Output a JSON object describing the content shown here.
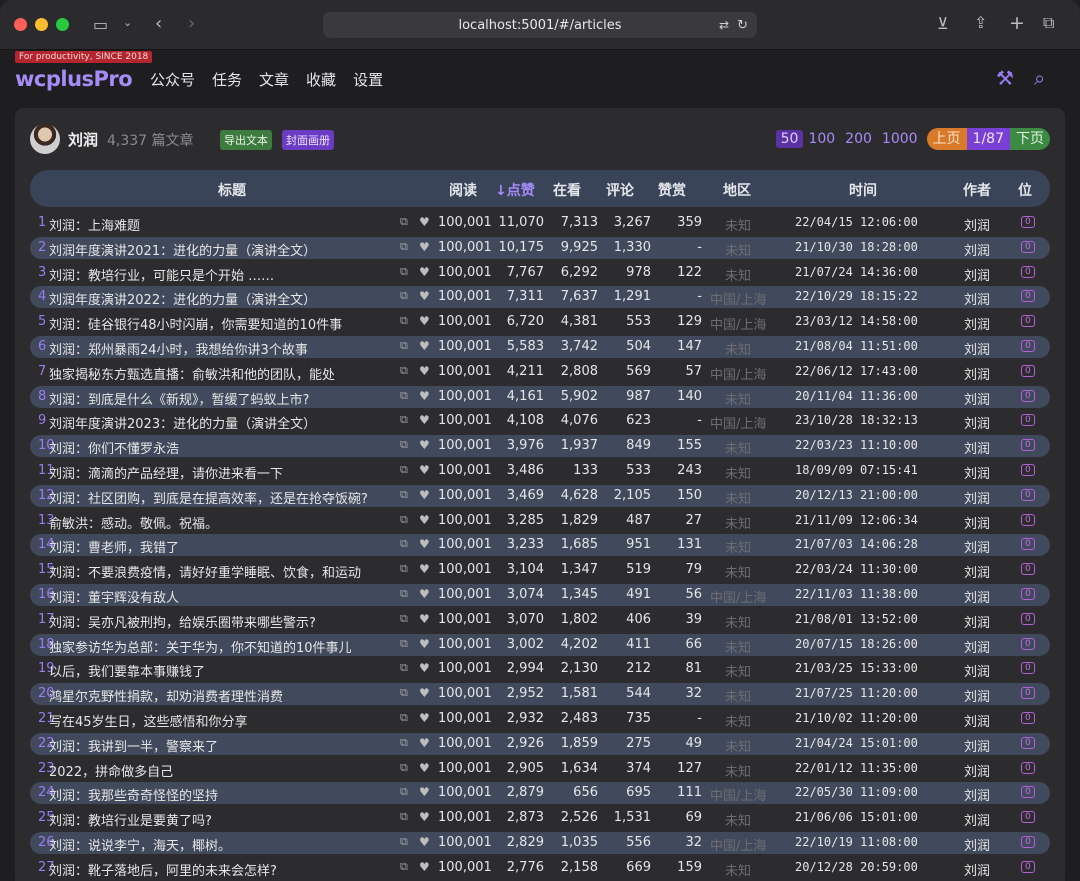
{
  "browser": {
    "url": "localhost:5001/#/articles"
  },
  "app": {
    "tagline": "For productivity, SINCE 2018",
    "logo": "wcplusPro",
    "nav": [
      "公众号",
      "任务",
      "文章",
      "收藏",
      "设置"
    ]
  },
  "header": {
    "author": "刘润",
    "count": "4,337 篇文章",
    "export_btn": "导出文本",
    "cover_btn": "封面画册",
    "page_sizes": [
      "50",
      "100",
      "200",
      "1000"
    ],
    "active_page_size": "50",
    "prev": "上页",
    "current": "1/87",
    "next": "下页"
  },
  "columns": {
    "title": "标题",
    "read": "阅读",
    "like": "↓点赞",
    "watch": "在看",
    "comment": "评论",
    "reward": "赞赏",
    "region": "地区",
    "time": "时间",
    "author": "作者",
    "pos": "位"
  },
  "rows": [
    {
      "i": "1",
      "t": "刘润：上海难题",
      "r": "100,001",
      "l": "11,070",
      "w": "7,313",
      "c": "3,267",
      "z": "359",
      "g": "未知",
      "d": "22/04/15 12:06:00",
      "a": "刘润",
      "p": "0"
    },
    {
      "i": "2",
      "t": "刘润年度演讲2021：进化的力量（演讲全文）",
      "r": "100,001",
      "l": "10,175",
      "w": "9,925",
      "c": "1,330",
      "z": "-",
      "g": "未知",
      "d": "21/10/30 18:28:00",
      "a": "刘润",
      "p": "0"
    },
    {
      "i": "3",
      "t": "刘润：教培行业，可能只是个开始 ……",
      "r": "100,001",
      "l": "7,767",
      "w": "6,292",
      "c": "978",
      "z": "122",
      "g": "未知",
      "d": "21/07/24 14:36:00",
      "a": "刘润",
      "p": "0"
    },
    {
      "i": "4",
      "t": "刘润年度演讲2022：进化的力量（演讲全文）",
      "r": "100,001",
      "l": "7,311",
      "w": "7,637",
      "c": "1,291",
      "z": "-",
      "g": "中国/上海",
      "d": "22/10/29 18:15:22",
      "a": "刘润",
      "p": "0"
    },
    {
      "i": "5",
      "t": "刘润：硅谷银行48小时闪崩，你需要知道的10件事",
      "r": "100,001",
      "l": "6,720",
      "w": "4,381",
      "c": "553",
      "z": "129",
      "g": "中国/上海",
      "d": "23/03/12 14:58:00",
      "a": "刘润",
      "p": "0"
    },
    {
      "i": "6",
      "t": "刘润：郑州暴雨24小时，我想给你讲3个故事",
      "r": "100,001",
      "l": "5,583",
      "w": "3,742",
      "c": "504",
      "z": "147",
      "g": "未知",
      "d": "21/08/04 11:51:00",
      "a": "刘润",
      "p": "0"
    },
    {
      "i": "7",
      "t": "独家揭秘东方甄选直播：俞敏洪和他的团队，能处",
      "r": "100,001",
      "l": "4,211",
      "w": "2,808",
      "c": "569",
      "z": "57",
      "g": "中国/上海",
      "d": "22/06/12 17:43:00",
      "a": "刘润",
      "p": "0"
    },
    {
      "i": "8",
      "t": "刘润：到底是什么《新规》，暂缓了蚂蚁上市?",
      "r": "100,001",
      "l": "4,161",
      "w": "5,902",
      "c": "987",
      "z": "140",
      "g": "未知",
      "d": "20/11/04 11:36:00",
      "a": "刘润",
      "p": "0"
    },
    {
      "i": "9",
      "t": "刘润年度演讲2023：进化的力量（演讲全文）",
      "r": "100,001",
      "l": "4,108",
      "w": "4,076",
      "c": "623",
      "z": "-",
      "g": "中国/上海",
      "d": "23/10/28 18:32:13",
      "a": "刘润",
      "p": "0"
    },
    {
      "i": "10",
      "t": "刘润：你们不懂罗永浩",
      "r": "100,001",
      "l": "3,976",
      "w": "1,937",
      "c": "849",
      "z": "155",
      "g": "未知",
      "d": "22/03/23 11:10:00",
      "a": "刘润",
      "p": "0"
    },
    {
      "i": "11",
      "t": "刘润：滴滴的产品经理，请你进来看一下",
      "r": "100,001",
      "l": "3,486",
      "w": "133",
      "c": "533",
      "z": "243",
      "g": "未知",
      "d": "18/09/09 07:15:41",
      "a": "刘润",
      "p": "0"
    },
    {
      "i": "12",
      "t": "刘润：社区团购，到底是在提高效率，还是在抢夺饭碗?",
      "r": "100,001",
      "l": "3,469",
      "w": "4,628",
      "c": "2,105",
      "z": "150",
      "g": "未知",
      "d": "20/12/13 21:00:00",
      "a": "刘润",
      "p": "0"
    },
    {
      "i": "13",
      "t": "俞敏洪：感动。敬佩。祝福。",
      "r": "100,001",
      "l": "3,285",
      "w": "1,829",
      "c": "487",
      "z": "27",
      "g": "未知",
      "d": "21/11/09 12:06:34",
      "a": "刘润",
      "p": "0"
    },
    {
      "i": "14",
      "t": "刘润：曹老师，我错了",
      "r": "100,001",
      "l": "3,233",
      "w": "1,685",
      "c": "951",
      "z": "131",
      "g": "未知",
      "d": "21/07/03 14:06:28",
      "a": "刘润",
      "p": "0"
    },
    {
      "i": "15",
      "t": "刘润：不要浪费疫情，请好好重学睡眠、饮食，和运动",
      "r": "100,001",
      "l": "3,104",
      "w": "1,347",
      "c": "519",
      "z": "79",
      "g": "未知",
      "d": "22/03/24 11:30:00",
      "a": "刘润",
      "p": "0"
    },
    {
      "i": "16",
      "t": "刘润：董宇辉没有敌人",
      "r": "100,001",
      "l": "3,074",
      "w": "1,345",
      "c": "491",
      "z": "56",
      "g": "中国/上海",
      "d": "22/11/03 11:38:00",
      "a": "刘润",
      "p": "0"
    },
    {
      "i": "17",
      "t": "刘润：吴亦凡被刑拘，给娱乐圈带来哪些警示?",
      "r": "100,001",
      "l": "3,070",
      "w": "1,802",
      "c": "406",
      "z": "39",
      "g": "未知",
      "d": "21/08/01 13:52:00",
      "a": "刘润",
      "p": "0"
    },
    {
      "i": "18",
      "t": "独家参访华为总部：关于华为，你不知道的10件事儿",
      "r": "100,001",
      "l": "3,002",
      "w": "4,202",
      "c": "411",
      "z": "66",
      "g": "未知",
      "d": "20/07/15 18:26:00",
      "a": "刘润",
      "p": "0"
    },
    {
      "i": "19",
      "t": "以后，我们要靠本事赚钱了",
      "r": "100,001",
      "l": "2,994",
      "w": "2,130",
      "c": "212",
      "z": "81",
      "g": "未知",
      "d": "21/03/25 15:33:00",
      "a": "刘润",
      "p": "0"
    },
    {
      "i": "20",
      "t": "鸿星尔克野性捐款，却劝消费者理性消费",
      "r": "100,001",
      "l": "2,952",
      "w": "1,581",
      "c": "544",
      "z": "32",
      "g": "未知",
      "d": "21/07/25 11:20:00",
      "a": "刘润",
      "p": "0"
    },
    {
      "i": "21",
      "t": "写在45岁生日，这些感悟和你分享",
      "r": "100,001",
      "l": "2,932",
      "w": "2,483",
      "c": "735",
      "z": "-",
      "g": "未知",
      "d": "21/10/02 11:20:00",
      "a": "刘润",
      "p": "0"
    },
    {
      "i": "22",
      "t": "刘润：我讲到一半，警察来了",
      "r": "100,001",
      "l": "2,926",
      "w": "1,859",
      "c": "275",
      "z": "49",
      "g": "未知",
      "d": "21/04/24 15:01:00",
      "a": "刘润",
      "p": "0"
    },
    {
      "i": "23",
      "t": "2022，拼命做多自己",
      "r": "100,001",
      "l": "2,905",
      "w": "1,634",
      "c": "374",
      "z": "127",
      "g": "未知",
      "d": "22/01/12 11:35:00",
      "a": "刘润",
      "p": "0"
    },
    {
      "i": "24",
      "t": "刘润：我那些奇奇怪怪的坚持",
      "r": "100,001",
      "l": "2,879",
      "w": "656",
      "c": "695",
      "z": "111",
      "g": "中国/上海",
      "d": "22/05/30 11:09:00",
      "a": "刘润",
      "p": "0"
    },
    {
      "i": "25",
      "t": "刘润：教培行业是要黄了吗?",
      "r": "100,001",
      "l": "2,873",
      "w": "2,526",
      "c": "1,531",
      "z": "69",
      "g": "未知",
      "d": "21/06/06 15:01:00",
      "a": "刘润",
      "p": "0"
    },
    {
      "i": "26",
      "t": "刘润：说说李宁，海天，椰树。",
      "r": "100,001",
      "l": "2,829",
      "w": "1,035",
      "c": "556",
      "z": "32",
      "g": "中国/上海",
      "d": "22/10/19 11:08:00",
      "a": "刘润",
      "p": "0"
    },
    {
      "i": "27",
      "t": "刘润：靴子落地后，阿里的未来会怎样?",
      "r": "100,001",
      "l": "2,776",
      "w": "2,158",
      "c": "669",
      "z": "159",
      "g": "未知",
      "d": "20/12/28 20:59:00",
      "a": "刘润",
      "p": "0"
    }
  ]
}
